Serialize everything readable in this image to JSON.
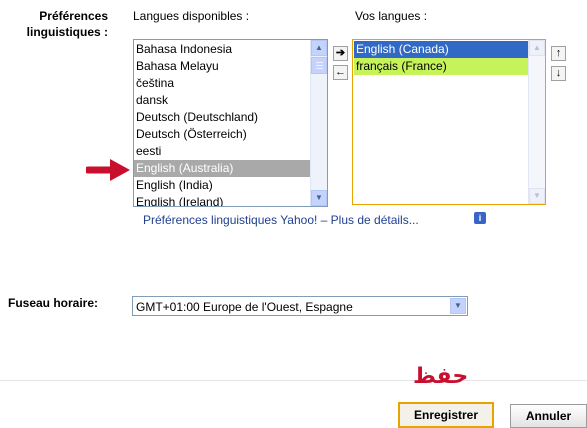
{
  "labels": {
    "pref_line1": "Préférences",
    "pref_line2": "linguistiques :",
    "available": "Langues disponibles :",
    "yours": "Vos langues :",
    "timezone": "Fuseau horaire:"
  },
  "available_list": {
    "items": [
      "Bahasa Indonesia",
      "Bahasa Melayu",
      "čeština",
      "dansk",
      "Deutsch (Deutschland)",
      "Deutsch (Österreich)",
      "eesti",
      "English (Australia)",
      "English (India)",
      "English (Ireland)"
    ],
    "selected": "English (Australia)"
  },
  "your_list": {
    "items": [
      "English (Canada)",
      "français (France)"
    ]
  },
  "yahoo_link": "Préférences linguistiques Yahoo! – Plus de détails...",
  "timezone_value": "GMT+01:00 Europe de l'Ouest, Espagne",
  "annotation_text": "حفظ",
  "buttons": {
    "save": "Enregistrer",
    "cancel": "Annuler"
  },
  "colors": {
    "arrow_annotation": "#c8102e",
    "selected_blue": "#316ac5",
    "highlight_green": "#c6f25a",
    "save_border": "#e8a300",
    "link": "#1f3f8f"
  },
  "icons": {
    "move_right": "arrow-right-icon",
    "move_left": "arrow-left-icon",
    "move_up": "arrow-up-icon",
    "move_down": "arrow-down-icon",
    "info": "info-icon",
    "dropdown": "chevron-down-icon"
  }
}
